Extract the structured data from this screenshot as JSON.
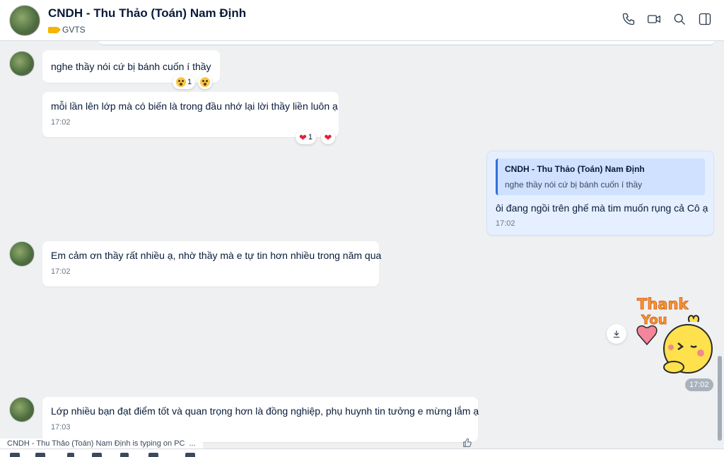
{
  "header": {
    "title": "CNDH - Thu Thảo (Toán) Nam Định",
    "tag_label": "GVTS",
    "tag_color": "#f5b400",
    "actions": [
      "phone-icon",
      "video-call-icon",
      "search-icon",
      "sidebar-toggle-icon"
    ]
  },
  "messages": [
    {
      "sender": "other",
      "text": "nghe thầy nói cứ bị bánh cuốn í thầy",
      "reactions": {
        "count": "1",
        "emoji": "astonished-face"
      }
    },
    {
      "sender": "other",
      "text": "mỗi lần lên lớp mà có biến là trong đầu nhớ lại lời thầy liền luôn ạ",
      "time": "17:02",
      "reactions": {
        "count": "1",
        "emoji": "red-heart"
      }
    },
    {
      "sender": "me",
      "quote_title": "CNDH - Thu Thảo (Toán) Nam Định",
      "quote_text": "nghe thầy nói cứ bị bánh cuốn í thầy",
      "text": "ôi đang ngồi trên ghế mà tim muốn rụng cả Cô ạ",
      "time": "17:02"
    },
    {
      "sender": "other",
      "text": "Em cảm ơn thầy rất nhiều ạ, nhờ thầy mà e tự tin hơn nhiều trong năm qua",
      "time": "17:02"
    },
    {
      "sender": "me",
      "sticker": "Thank You",
      "time": "17:02"
    },
    {
      "sender": "other",
      "text": "Lớp nhiều bạn đạt điểm tốt và quan trọng hơn là đồng nghiệp, phụ huynh tin tưởng e mừng lắm ạ",
      "time": "17:03"
    }
  ],
  "typing_indicator": "CNDH - Thu Thảo (Toán) Nam Định is typing on PC",
  "typing_dots": "...",
  "colors": {
    "my_bubble": "#e5efff",
    "other_bubble": "#ffffff",
    "background": "#eef0f1",
    "accent": "#2f6fdb"
  }
}
